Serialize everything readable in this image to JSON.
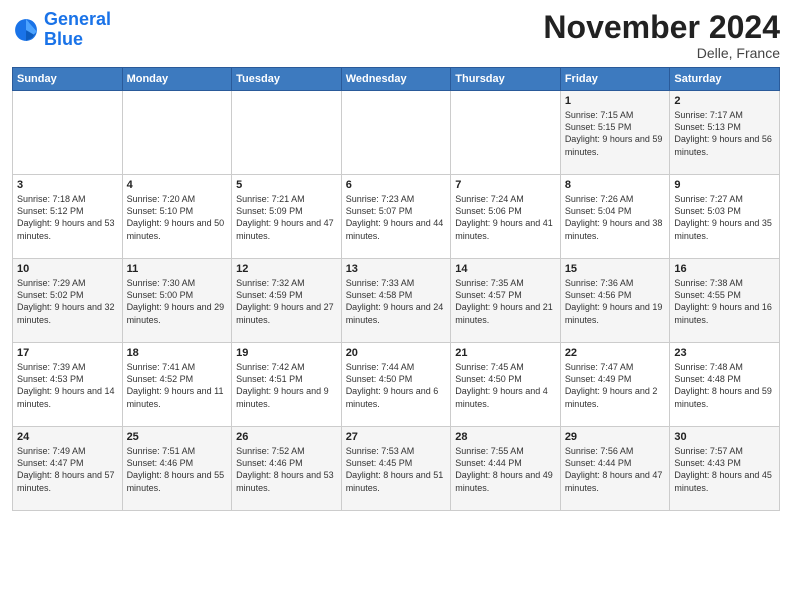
{
  "logo": {
    "line1": "General",
    "line2": "Blue"
  },
  "title": "November 2024",
  "location": "Delle, France",
  "days_header": [
    "Sunday",
    "Monday",
    "Tuesday",
    "Wednesday",
    "Thursday",
    "Friday",
    "Saturday"
  ],
  "weeks": [
    [
      {
        "day": "",
        "info": ""
      },
      {
        "day": "",
        "info": ""
      },
      {
        "day": "",
        "info": ""
      },
      {
        "day": "",
        "info": ""
      },
      {
        "day": "",
        "info": ""
      },
      {
        "day": "1",
        "info": "Sunrise: 7:15 AM\nSunset: 5:15 PM\nDaylight: 9 hours and 59 minutes."
      },
      {
        "day": "2",
        "info": "Sunrise: 7:17 AM\nSunset: 5:13 PM\nDaylight: 9 hours and 56 minutes."
      }
    ],
    [
      {
        "day": "3",
        "info": "Sunrise: 7:18 AM\nSunset: 5:12 PM\nDaylight: 9 hours and 53 minutes."
      },
      {
        "day": "4",
        "info": "Sunrise: 7:20 AM\nSunset: 5:10 PM\nDaylight: 9 hours and 50 minutes."
      },
      {
        "day": "5",
        "info": "Sunrise: 7:21 AM\nSunset: 5:09 PM\nDaylight: 9 hours and 47 minutes."
      },
      {
        "day": "6",
        "info": "Sunrise: 7:23 AM\nSunset: 5:07 PM\nDaylight: 9 hours and 44 minutes."
      },
      {
        "day": "7",
        "info": "Sunrise: 7:24 AM\nSunset: 5:06 PM\nDaylight: 9 hours and 41 minutes."
      },
      {
        "day": "8",
        "info": "Sunrise: 7:26 AM\nSunset: 5:04 PM\nDaylight: 9 hours and 38 minutes."
      },
      {
        "day": "9",
        "info": "Sunrise: 7:27 AM\nSunset: 5:03 PM\nDaylight: 9 hours and 35 minutes."
      }
    ],
    [
      {
        "day": "10",
        "info": "Sunrise: 7:29 AM\nSunset: 5:02 PM\nDaylight: 9 hours and 32 minutes."
      },
      {
        "day": "11",
        "info": "Sunrise: 7:30 AM\nSunset: 5:00 PM\nDaylight: 9 hours and 29 minutes."
      },
      {
        "day": "12",
        "info": "Sunrise: 7:32 AM\nSunset: 4:59 PM\nDaylight: 9 hours and 27 minutes."
      },
      {
        "day": "13",
        "info": "Sunrise: 7:33 AM\nSunset: 4:58 PM\nDaylight: 9 hours and 24 minutes."
      },
      {
        "day": "14",
        "info": "Sunrise: 7:35 AM\nSunset: 4:57 PM\nDaylight: 9 hours and 21 minutes."
      },
      {
        "day": "15",
        "info": "Sunrise: 7:36 AM\nSunset: 4:56 PM\nDaylight: 9 hours and 19 minutes."
      },
      {
        "day": "16",
        "info": "Sunrise: 7:38 AM\nSunset: 4:55 PM\nDaylight: 9 hours and 16 minutes."
      }
    ],
    [
      {
        "day": "17",
        "info": "Sunrise: 7:39 AM\nSunset: 4:53 PM\nDaylight: 9 hours and 14 minutes."
      },
      {
        "day": "18",
        "info": "Sunrise: 7:41 AM\nSunset: 4:52 PM\nDaylight: 9 hours and 11 minutes."
      },
      {
        "day": "19",
        "info": "Sunrise: 7:42 AM\nSunset: 4:51 PM\nDaylight: 9 hours and 9 minutes."
      },
      {
        "day": "20",
        "info": "Sunrise: 7:44 AM\nSunset: 4:50 PM\nDaylight: 9 hours and 6 minutes."
      },
      {
        "day": "21",
        "info": "Sunrise: 7:45 AM\nSunset: 4:50 PM\nDaylight: 9 hours and 4 minutes."
      },
      {
        "day": "22",
        "info": "Sunrise: 7:47 AM\nSunset: 4:49 PM\nDaylight: 9 hours and 2 minutes."
      },
      {
        "day": "23",
        "info": "Sunrise: 7:48 AM\nSunset: 4:48 PM\nDaylight: 8 hours and 59 minutes."
      }
    ],
    [
      {
        "day": "24",
        "info": "Sunrise: 7:49 AM\nSunset: 4:47 PM\nDaylight: 8 hours and 57 minutes."
      },
      {
        "day": "25",
        "info": "Sunrise: 7:51 AM\nSunset: 4:46 PM\nDaylight: 8 hours and 55 minutes."
      },
      {
        "day": "26",
        "info": "Sunrise: 7:52 AM\nSunset: 4:46 PM\nDaylight: 8 hours and 53 minutes."
      },
      {
        "day": "27",
        "info": "Sunrise: 7:53 AM\nSunset: 4:45 PM\nDaylight: 8 hours and 51 minutes."
      },
      {
        "day": "28",
        "info": "Sunrise: 7:55 AM\nSunset: 4:44 PM\nDaylight: 8 hours and 49 minutes."
      },
      {
        "day": "29",
        "info": "Sunrise: 7:56 AM\nSunset: 4:44 PM\nDaylight: 8 hours and 47 minutes."
      },
      {
        "day": "30",
        "info": "Sunrise: 7:57 AM\nSunset: 4:43 PM\nDaylight: 8 hours and 45 minutes."
      }
    ]
  ]
}
